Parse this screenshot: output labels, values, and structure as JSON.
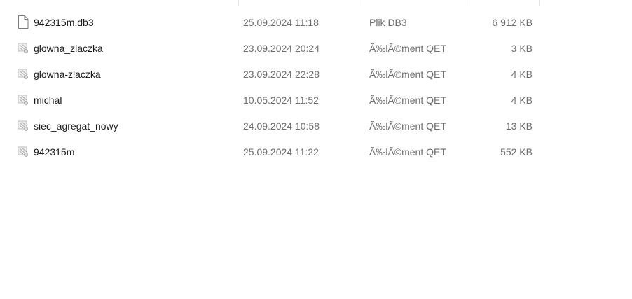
{
  "files": [
    {
      "name": "942315m.db3",
      "date": "25.09.2024 11:18",
      "type": "Plik DB3",
      "size": "6 912 KB",
      "icon": "blank-document-icon"
    },
    {
      "name": "glowna_zlaczka",
      "date": "23.09.2024 20:24",
      "type": "Ã‰lÃ©ment QET",
      "size": "3 KB",
      "icon": "qet-element-icon"
    },
    {
      "name": "glowna-zlaczka",
      "date": "23.09.2024 22:28",
      "type": "Ã‰lÃ©ment QET",
      "size": "4 KB",
      "icon": "qet-element-icon"
    },
    {
      "name": "michal",
      "date": "10.05.2024 11:52",
      "type": "Ã‰lÃ©ment QET",
      "size": "4 KB",
      "icon": "qet-element-icon"
    },
    {
      "name": "siec_agregat_nowy",
      "date": "24.09.2024 10:58",
      "type": "Ã‰lÃ©ment QET",
      "size": "13 KB",
      "icon": "qet-element-icon"
    },
    {
      "name": "942315m",
      "date": "25.09.2024 11:22",
      "type": "Ã‰lÃ©ment QET",
      "size": "552 KB",
      "icon": "qet-element-icon"
    }
  ]
}
